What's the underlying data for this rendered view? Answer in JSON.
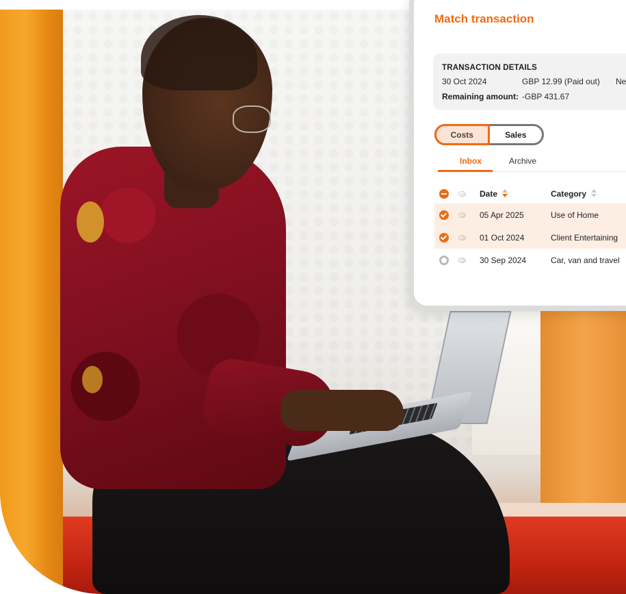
{
  "card": {
    "title": "Match transaction",
    "transaction_details": {
      "heading": "TRANSACTION DETAILS",
      "date": "30 Oct 2024",
      "amount": "GBP 12.99 (Paid out)",
      "net_label": "Net",
      "remaining_label": "Remaining amount:",
      "remaining_value": "-GBP 431.67"
    },
    "toggle": {
      "costs": "Costs",
      "sales": "Sales",
      "selected": "Costs"
    },
    "tabs": [
      {
        "label": "Inbox",
        "active": true
      },
      {
        "label": "Archive",
        "active": false
      }
    ],
    "table": {
      "columns": [
        "Date",
        "Category"
      ],
      "rows": [
        {
          "date": "05 Apr 2025",
          "category": "Use of Home",
          "checked": true
        },
        {
          "date": "01 Oct 2024",
          "category": "Client Entertaining",
          "checked": true
        },
        {
          "date": "30 Sep 2024",
          "category": "Car, van and travel",
          "checked": false
        }
      ]
    }
  },
  "colors": {
    "accent": "#f06a12",
    "selected_row": "#fdeee4",
    "panel_bg": "#f2f2f2",
    "shirt": "#8c1222",
    "curtain": "#f19a1c",
    "bench": "#d2301a"
  },
  "icons": [
    "select-all-minus-icon",
    "eye-icon",
    "checkbox-checked-icon",
    "checkbox-empty-icon",
    "sort-icon"
  ]
}
